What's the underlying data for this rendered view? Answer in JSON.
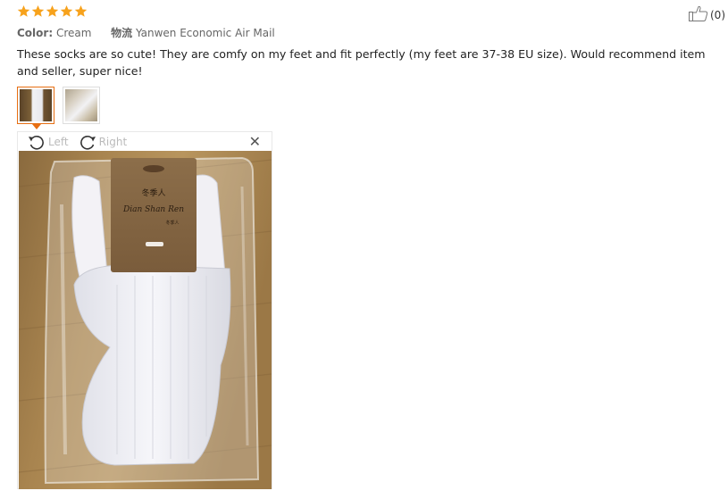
{
  "rating": {
    "stars": 5,
    "star_icon": "star-icon",
    "color": "#f7a21c"
  },
  "helpful": {
    "icon": "thumbs-up-icon",
    "count_text": "(0)"
  },
  "attributes": {
    "color_label": "Color:",
    "color_value": "Cream",
    "shipping_label": "物流",
    "shipping_value": "Yanwen Economic Air Mail"
  },
  "review_text": "These socks are so cute! They are comfy on my feet and fit perfectly (my feet are 37-38 EU size). Would recommend item and seller, super nice!",
  "thumbnails": [
    {
      "alt": "photo 1",
      "active": true
    },
    {
      "alt": "photo 2",
      "active": false
    }
  ],
  "viewer": {
    "rotate_left_label": "Left",
    "rotate_right_label": "Right",
    "close_icon": "close-icon",
    "package_brand_top": "冬季人",
    "package_brand_script": "Dian Shan Ren",
    "package_brand_small": "冬季人"
  },
  "colors": {
    "accent": "#e76e12",
    "text": "#333333",
    "muted": "#666666"
  }
}
